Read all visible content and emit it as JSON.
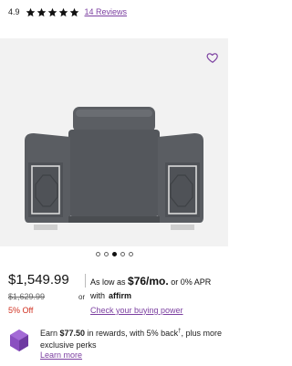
{
  "rating": {
    "value": "4.9",
    "stars": 5,
    "reviews_label": "14 Reviews"
  },
  "carousel": {
    "count": 5,
    "active_index": 2
  },
  "price": {
    "current": "$1,549.99",
    "original": "$1,629.99",
    "discount": "5% Off",
    "or_label": "or"
  },
  "financing": {
    "prefix": "As low as ",
    "amount": "$76/mo.",
    "suffix_or": " or ",
    "apr": "0% APR",
    "with_label": "with",
    "provider": "affirm",
    "check_link": "Check your buying power"
  },
  "rewards": {
    "earn_prefix": "Earn ",
    "amount": "$77.50",
    "earn_suffix": " in rewards, with 5% back",
    "sup": "†",
    "line_rest": ", plus more exclusive perks",
    "learn_more": "Learn more"
  },
  "colors": {
    "accent": "#7b3fa0",
    "discount": "#d03020",
    "star": "#111111",
    "image_bg": "#f2f2f2"
  }
}
